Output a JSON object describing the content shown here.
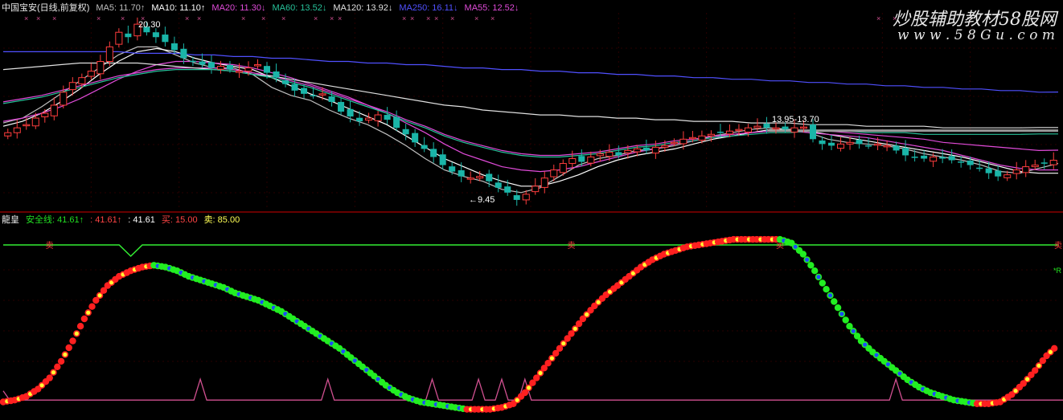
{
  "top_panel": {
    "stock_title": "中国宝安(日线,前复权)",
    "ma_labels": [
      {
        "text": "MA5: 11.70",
        "arrow": "↑",
        "color": "#bfbfbf"
      },
      {
        "text": "MA10: 11.10",
        "arrow": "↑",
        "color": "#ffffff"
      },
      {
        "text": "MA20: 11.30",
        "arrow": "↓",
        "color": "#e04bd9"
      },
      {
        "text": "MA60: 13.52",
        "arrow": "↓",
        "color": "#27c29a"
      },
      {
        "text": "MA120: 13.92",
        "arrow": "↓",
        "color": "#e0e0e0"
      },
      {
        "text": "MA250: 16.11",
        "arrow": "↓",
        "color": "#5050ff"
      },
      {
        "text": "MA55: 12.52",
        "arrow": "↓",
        "color": "#e04bd9"
      }
    ],
    "annotations": {
      "high": "20.30",
      "low": "←9.45",
      "range": "13.95-13.70"
    }
  },
  "watermark": {
    "title": "炒股辅助教材58股网",
    "url": "w w w . 5 8 G u . c o m"
  },
  "bottom_panel": {
    "indicator_name": "龍皇",
    "labels": [
      {
        "text": "安全线: 41.61",
        "arrow": "↑",
        "color": "#22dd22"
      },
      {
        "text": ": 41.61",
        "arrow": "↑",
        "color": "#ff4444"
      },
      {
        "text": ": 41.61",
        "arrow": "",
        "color": "#ffffff"
      },
      {
        "text": "买: 15.00",
        "arrow": "",
        "color": "#ff4444"
      },
      {
        "text": "卖: 85.00",
        "arrow": "",
        "color": "#ffff55"
      }
    ],
    "sell_marker": "卖",
    "side_tag": "*R"
  },
  "colors": {
    "up_candle": "#ff3d3d",
    "down_candle": "#1ab5a8",
    "separator": "#8a0000",
    "green_line": "#33ee33",
    "red_dot": "#ff2020",
    "green_dot": "#22ee22",
    "yellow_dot": "#ffff33",
    "blue_dot": "#1d4bff",
    "pink_line": "#d05090",
    "watermark": "#e8e8e8"
  },
  "chart_data": [
    {
      "type": "candlestick",
      "series": [
        {
          "name": "MA5",
          "color": "#bfbfbf"
        },
        {
          "name": "MA10",
          "color": "#ffffff"
        },
        {
          "name": "MA20",
          "color": "#e04bd9"
        },
        {
          "name": "MA60",
          "color": "#27c29a"
        },
        {
          "name": "MA120",
          "color": "#e0e0e0"
        },
        {
          "name": "MA250",
          "color": "#5050ff"
        },
        {
          "name": "MA55",
          "color": "#e04bd9"
        }
      ],
      "ylim": [
        9.0,
        21.0
      ],
      "close_price": [
        13.6,
        13.9,
        14.1,
        14.5,
        14.8,
        15.3,
        16.1,
        16.7,
        17.0,
        17.4,
        18.0,
        18.9,
        19.8,
        19.5,
        20.3,
        19.8,
        19.5,
        19.2,
        18.7,
        18.2,
        18.0,
        17.8,
        17.6,
        17.7,
        17.5,
        17.4,
        17.6,
        17.8,
        17.3,
        17.0,
        16.6,
        16.2,
        16.0,
        15.9,
        16.0,
        15.5,
        14.9,
        14.6,
        14.3,
        14.5,
        14.7,
        14.4,
        13.9,
        13.5,
        13.0,
        12.6,
        12.1,
        11.6,
        11.2,
        10.9,
        10.8,
        10.9,
        10.6,
        10.2,
        9.9,
        9.45,
        9.8,
        10.3,
        10.8,
        11.3,
        11.7,
        12.0,
        11.8,
        12.1,
        12.3,
        12.4,
        12.2,
        12.5,
        12.6,
        12.5,
        12.7,
        12.8,
        13.0,
        13.2,
        13.3,
        13.4,
        13.5,
        13.6,
        13.7,
        13.8,
        13.9,
        14.0,
        13.9,
        13.9,
        13.8,
        13.9,
        13.95,
        13.2,
        12.9,
        12.8,
        12.9,
        13.0,
        12.9,
        12.8,
        12.9,
        12.8,
        12.5,
        12.2,
        12.1,
        12.0,
        12.1,
        12.0,
        11.9,
        11.8,
        11.6,
        11.4,
        11.1,
        10.9,
        11.0,
        11.3,
        11.5,
        11.6,
        11.7,
        11.9
      ],
      "ma_values": {
        "MA5": [
          14.2,
          14.5,
          15.2,
          16.0,
          16.8,
          17.6,
          18.4,
          18.9,
          18.9,
          18.4,
          17.9,
          17.6,
          17.6,
          17.2,
          16.4,
          15.9,
          15.6,
          15.0,
          14.5,
          14.1,
          13.5,
          12.8,
          12.0,
          11.3,
          10.9,
          10.6,
          10.1,
          9.9,
          10.2,
          10.9,
          11.6,
          12.0,
          12.2,
          12.5,
          12.6,
          12.8,
          13.1,
          13.4,
          13.6,
          13.8,
          13.9,
          13.8,
          13.6,
          13.2,
          13.0,
          12.9,
          12.8,
          12.6,
          12.3,
          12.1,
          11.9,
          11.6,
          11.2,
          11.1,
          11.4,
          11.7
        ],
        "MA10": [
          14.0,
          14.3,
          14.8,
          15.5,
          16.3,
          17.2,
          18.0,
          18.6,
          18.8,
          18.6,
          18.2,
          17.9,
          17.7,
          17.5,
          17.0,
          16.5,
          16.0,
          15.6,
          15.1,
          14.6,
          14.1,
          13.4,
          12.7,
          12.0,
          11.5,
          11.0,
          10.6,
          10.3,
          10.3,
          10.6,
          11.0,
          11.5,
          11.9,
          12.2,
          12.4,
          12.6,
          12.9,
          13.2,
          13.4,
          13.6,
          13.8,
          13.8,
          13.7,
          13.5,
          13.3,
          13.1,
          12.9,
          12.7,
          12.5,
          12.3,
          12.1,
          11.8,
          11.5,
          11.2,
          11.1,
          11.1
        ],
        "MA20": [
          14.3,
          14.5,
          14.8,
          15.2,
          15.7,
          16.3,
          16.9,
          17.4,
          17.8,
          18.0,
          18.0,
          17.9,
          17.8,
          17.6,
          17.3,
          17.0,
          16.6,
          16.2,
          15.8,
          15.3,
          14.8,
          14.2,
          13.6,
          12.9,
          12.3,
          11.9,
          11.5,
          11.3,
          11.2,
          11.3,
          11.5,
          11.8,
          12.1,
          12.4,
          12.6,
          12.9,
          13.1,
          13.3,
          13.5,
          13.6,
          13.7,
          13.7,
          13.6,
          13.5,
          13.4,
          13.3,
          13.1,
          12.9,
          12.7,
          12.5,
          12.2,
          11.9,
          11.6,
          11.4,
          11.3,
          11.3
        ],
        "MA55": [
          15.5,
          15.7,
          15.9,
          16.2,
          16.5,
          16.8,
          17.1,
          17.3,
          17.5,
          17.6,
          17.6,
          17.6,
          17.5,
          17.3,
          17.1,
          16.8,
          16.5,
          16.1,
          15.7,
          15.3,
          14.9,
          14.4,
          14.0,
          13.5,
          13.1,
          12.8,
          12.5,
          12.3,
          12.2,
          12.2,
          12.3,
          12.4,
          12.6,
          12.8,
          12.9,
          13.1,
          13.2,
          13.4,
          13.5,
          13.6,
          13.7,
          13.7,
          13.7,
          13.7,
          13.6,
          13.5,
          13.4,
          13.3,
          13.2,
          13.0,
          12.9,
          12.8,
          12.7,
          12.6,
          12.5,
          12.52
        ],
        "MA120": [
          17.5,
          17.6,
          17.7,
          17.8,
          17.9,
          17.9,
          17.9,
          17.9,
          17.8,
          17.7,
          17.6,
          17.5,
          17.4,
          17.2,
          17.1,
          16.9,
          16.7,
          16.5,
          16.3,
          16.1,
          15.9,
          15.7,
          15.5,
          15.3,
          15.2,
          15.0,
          14.9,
          14.8,
          14.7,
          14.7,
          14.6,
          14.6,
          14.5,
          14.5,
          14.4,
          14.4,
          14.3,
          14.3,
          14.3,
          14.2,
          14.2,
          14.2,
          14.1,
          14.1,
          14.1,
          14.0,
          14.0,
          14.0,
          14.0,
          13.9,
          13.9,
          13.9,
          13.9,
          13.9,
          13.92,
          13.92
        ],
        "MA250": [
          18.6,
          18.6,
          18.6,
          18.6,
          18.6,
          18.6,
          18.6,
          18.5,
          18.5,
          18.5,
          18.4,
          18.4,
          18.3,
          18.3,
          18.2,
          18.2,
          18.1,
          18.0,
          18.0,
          17.9,
          17.9,
          17.8,
          17.8,
          17.7,
          17.6,
          17.6,
          17.5,
          17.5,
          17.4,
          17.4,
          17.3,
          17.3,
          17.2,
          17.2,
          17.1,
          17.1,
          17.0,
          17.0,
          16.9,
          16.9,
          16.8,
          16.8,
          16.7,
          16.7,
          16.6,
          16.6,
          16.5,
          16.5,
          16.4,
          16.4,
          16.3,
          16.3,
          16.2,
          16.2,
          16.1,
          16.11
        ],
        "MA60": [
          15.4,
          15.6,
          15.8,
          16.1,
          16.4,
          16.7,
          17.0,
          17.2,
          17.4,
          17.5,
          17.5,
          17.5,
          17.4,
          17.2,
          17.0,
          16.7,
          16.4,
          16.0,
          15.6,
          15.2,
          14.8,
          14.3,
          13.9,
          13.4,
          13.0,
          12.7,
          12.4,
          12.2,
          12.1,
          12.1,
          12.2,
          12.3,
          12.5,
          12.7,
          12.8,
          13.0,
          13.1,
          13.3,
          13.4,
          13.5,
          13.6,
          13.6,
          13.7,
          13.7,
          13.7,
          13.6,
          13.6,
          13.6,
          13.5,
          13.5,
          13.5,
          13.5,
          13.5,
          13.5,
          13.52,
          13.52
        ]
      },
      "annotation_points": [
        {
          "label": "20.30",
          "value": 20.3
        },
        {
          "label": "←9.45",
          "value": 9.45
        },
        {
          "label": "13.95-13.70",
          "value": 13.95
        }
      ]
    },
    {
      "type": "line",
      "ylim": [
        0,
        100
      ],
      "safety_line": 41.61,
      "buy": 15.0,
      "sell": 85.0,
      "oscillator": [
        5,
        6,
        8,
        12,
        18,
        27,
        38,
        50,
        60,
        68,
        73,
        76,
        78,
        79,
        78,
        76,
        73,
        71,
        69,
        67,
        64,
        62,
        60,
        57,
        54,
        50,
        46,
        42,
        38,
        34,
        29,
        24,
        19,
        14,
        10,
        7,
        5,
        4,
        3,
        2,
        1,
        1,
        1,
        2,
        4,
        10,
        18,
        26,
        34,
        42,
        50,
        57,
        63,
        68,
        73,
        78,
        82,
        85,
        87,
        89,
        90,
        91,
        92,
        93,
        93,
        93,
        93,
        93,
        91,
        85,
        76,
        66,
        56,
        46,
        38,
        32,
        27,
        22,
        17,
        13,
        10,
        8,
        6,
        5,
        4,
        4,
        5,
        9,
        15,
        22,
        30,
        36
      ],
      "pink_line": [
        11,
        6,
        6,
        6,
        6,
        6,
        6,
        6,
        6,
        6,
        6,
        6,
        6,
        6,
        6,
        6,
        6,
        6,
        6,
        6,
        6,
        6,
        6,
        6,
        6,
        6,
        6,
        6,
        6,
        6,
        6,
        6,
        6,
        6,
        6,
        6,
        6,
        6,
        6,
        6,
        6,
        6,
        6,
        6,
        6,
        6,
        6,
        6,
        6,
        6,
        6,
        6,
        6,
        6,
        6,
        6,
        6,
        6,
        6,
        6,
        6,
        6,
        6,
        6,
        6,
        6,
        6,
        6,
        6,
        6,
        6,
        6,
        6,
        6,
        6,
        6,
        6,
        6,
        6,
        6,
        6,
        6,
        6,
        6,
        6,
        6,
        6,
        6,
        6,
        6,
        6,
        6
      ],
      "pink_spikes": [
        17,
        28,
        37,
        41,
        43,
        45,
        77,
        96
      ],
      "green_top_line": 90,
      "green_dip_index": 11,
      "sell_marker_positions": [
        4,
        49,
        67,
        100
      ]
    }
  ]
}
